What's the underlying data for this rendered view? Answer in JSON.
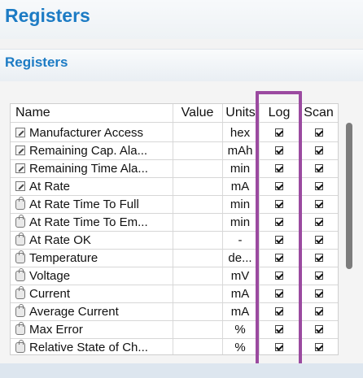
{
  "header": {
    "title": "Registers"
  },
  "section": {
    "title": "Registers"
  },
  "table": {
    "columns": {
      "name": "Name",
      "value": "Value",
      "units": "Units",
      "log": "Log",
      "scan": "Scan"
    },
    "rows": [
      {
        "name": "Manufacturer Access",
        "value": "",
        "units": "hex",
        "icon": "pencil-icon",
        "log": true,
        "scan": true
      },
      {
        "name": "Remaining Cap. Ala...",
        "value": "",
        "units": "mAh",
        "icon": "pencil-icon",
        "log": true,
        "scan": true
      },
      {
        "name": "Remaining Time Ala...",
        "value": "",
        "units": "min",
        "icon": "pencil-icon",
        "log": true,
        "scan": true
      },
      {
        "name": "At Rate",
        "value": "",
        "units": "mA",
        "icon": "pencil-icon",
        "log": true,
        "scan": true
      },
      {
        "name": "At Rate Time To Full",
        "value": "",
        "units": "min",
        "icon": "lock-icon",
        "log": true,
        "scan": true
      },
      {
        "name": "At Rate Time To Em...",
        "value": "",
        "units": "min",
        "icon": "lock-icon",
        "log": true,
        "scan": true
      },
      {
        "name": "At Rate OK",
        "value": "",
        "units": "-",
        "icon": "lock-icon",
        "log": true,
        "scan": true
      },
      {
        "name": "Temperature",
        "value": "",
        "units": "de...",
        "icon": "lock-icon",
        "log": true,
        "scan": true
      },
      {
        "name": "Voltage",
        "value": "",
        "units": "mV",
        "icon": "lock-icon",
        "log": true,
        "scan": true
      },
      {
        "name": "Current",
        "value": "",
        "units": "mA",
        "icon": "lock-icon",
        "log": true,
        "scan": true
      },
      {
        "name": "Average Current",
        "value": "",
        "units": "mA",
        "icon": "lock-icon",
        "log": true,
        "scan": true
      },
      {
        "name": "Max Error",
        "value": "",
        "units": "%",
        "icon": "lock-icon",
        "log": true,
        "scan": true
      },
      {
        "name": "Relative State of Ch...",
        "value": "",
        "units": "%",
        "icon": "lock-icon",
        "log": true,
        "scan": true
      }
    ]
  },
  "colors": {
    "title_blue": "#1c7bc4",
    "highlight_purple": "#9b4aa0"
  }
}
